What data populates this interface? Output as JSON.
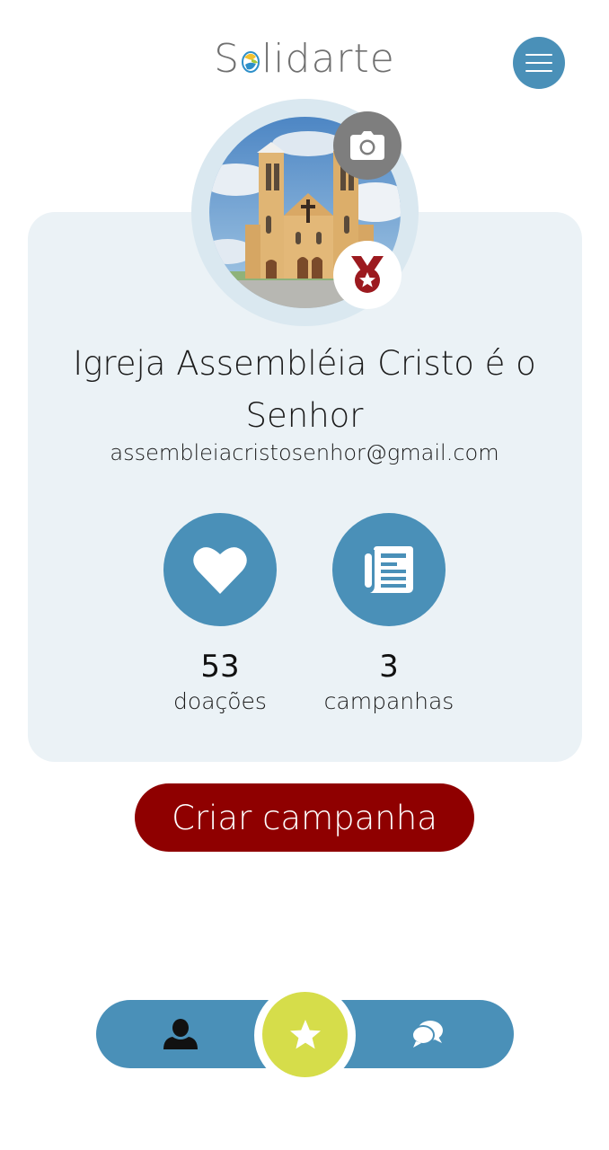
{
  "header": {
    "logo_text_before": "S",
    "logo_text_after": "lidarte",
    "logo_mark_colors": [
      "#f2c230",
      "#2d8fc9",
      "#a6c93c"
    ]
  },
  "profile": {
    "name": "Igreja Assembléia Cristo é o Senhor",
    "email": "assembleiacristosenhor@gmail.com",
    "avatar_icon": "church-photo",
    "camera_icon": "camera-icon",
    "badge_icon": "medal-icon"
  },
  "stats": [
    {
      "value": "53",
      "label": "doações",
      "icon": "heart-icon"
    },
    {
      "value": "3",
      "label": "campanhas",
      "icon": "newspaper-icon"
    }
  ],
  "actions": {
    "create_campaign_label": "Criar campanha"
  },
  "bottom_nav": {
    "items": [
      {
        "icon": "user-icon"
      },
      {
        "icon": "star-icon",
        "active": true
      },
      {
        "icon": "chat-icon"
      }
    ]
  },
  "colors": {
    "primary_blue": "#4a90b8",
    "card_bg": "#ebf2f6",
    "brand_red": "#8f0000",
    "accent_yellow": "#d6dd4a",
    "camera_gray": "#7e7e7e"
  }
}
